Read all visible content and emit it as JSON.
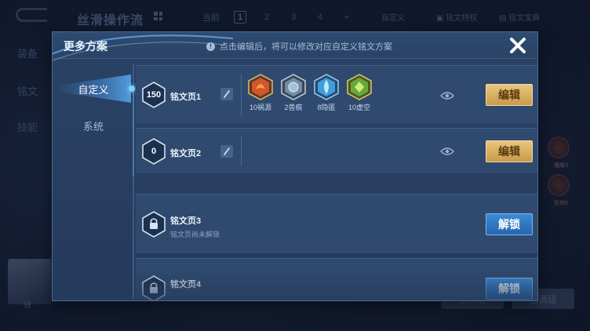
{
  "background": {
    "title": "丝滑操作流",
    "current_label": "当前",
    "pages": [
      "1",
      "2",
      "3",
      "4",
      "+"
    ],
    "custom_label": "自定义",
    "rune_privilege": "铭文特权",
    "rune_guide": "铭文宝典",
    "left_menu": [
      "装备",
      "铭文",
      "技能"
    ],
    "right_runes": [
      "鹰眼3",
      "狂热5"
    ],
    "bottom_buttons": [
      "去升级",
      "已满级"
    ],
    "portrait_label": "镜"
  },
  "modal": {
    "title": "更多方案",
    "hint": "点击编辑后，将可以修改对应自定义铭文方案",
    "tabs": [
      {
        "label": "自定义",
        "active": true
      },
      {
        "label": "系统",
        "active": false
      }
    ],
    "pages": [
      {
        "level": "150",
        "name": "铭文页1",
        "action": "编辑",
        "runes": [
          {
            "label": "10祸源",
            "color": "#d2552c"
          },
          {
            "label": "2兽痕",
            "color": "#6f8fa8"
          },
          {
            "label": "8隐匿",
            "color": "#3f9fd8"
          },
          {
            "label": "10虚空",
            "color": "#6aa83a"
          }
        ]
      },
      {
        "level": "0",
        "name": "铭文页2",
        "action": "编辑",
        "runes": []
      },
      {
        "level": "",
        "name": "铭文页3",
        "subtitle": "铭文页尚未解锁",
        "action": "解锁",
        "locked": true
      },
      {
        "level": "",
        "name": "铭文页4",
        "action": "解锁",
        "locked": true
      }
    ]
  },
  "colors": {
    "gold_button": "#d9b064",
    "blue_button": "#2f78c4",
    "accent": "#7fd0ff"
  }
}
